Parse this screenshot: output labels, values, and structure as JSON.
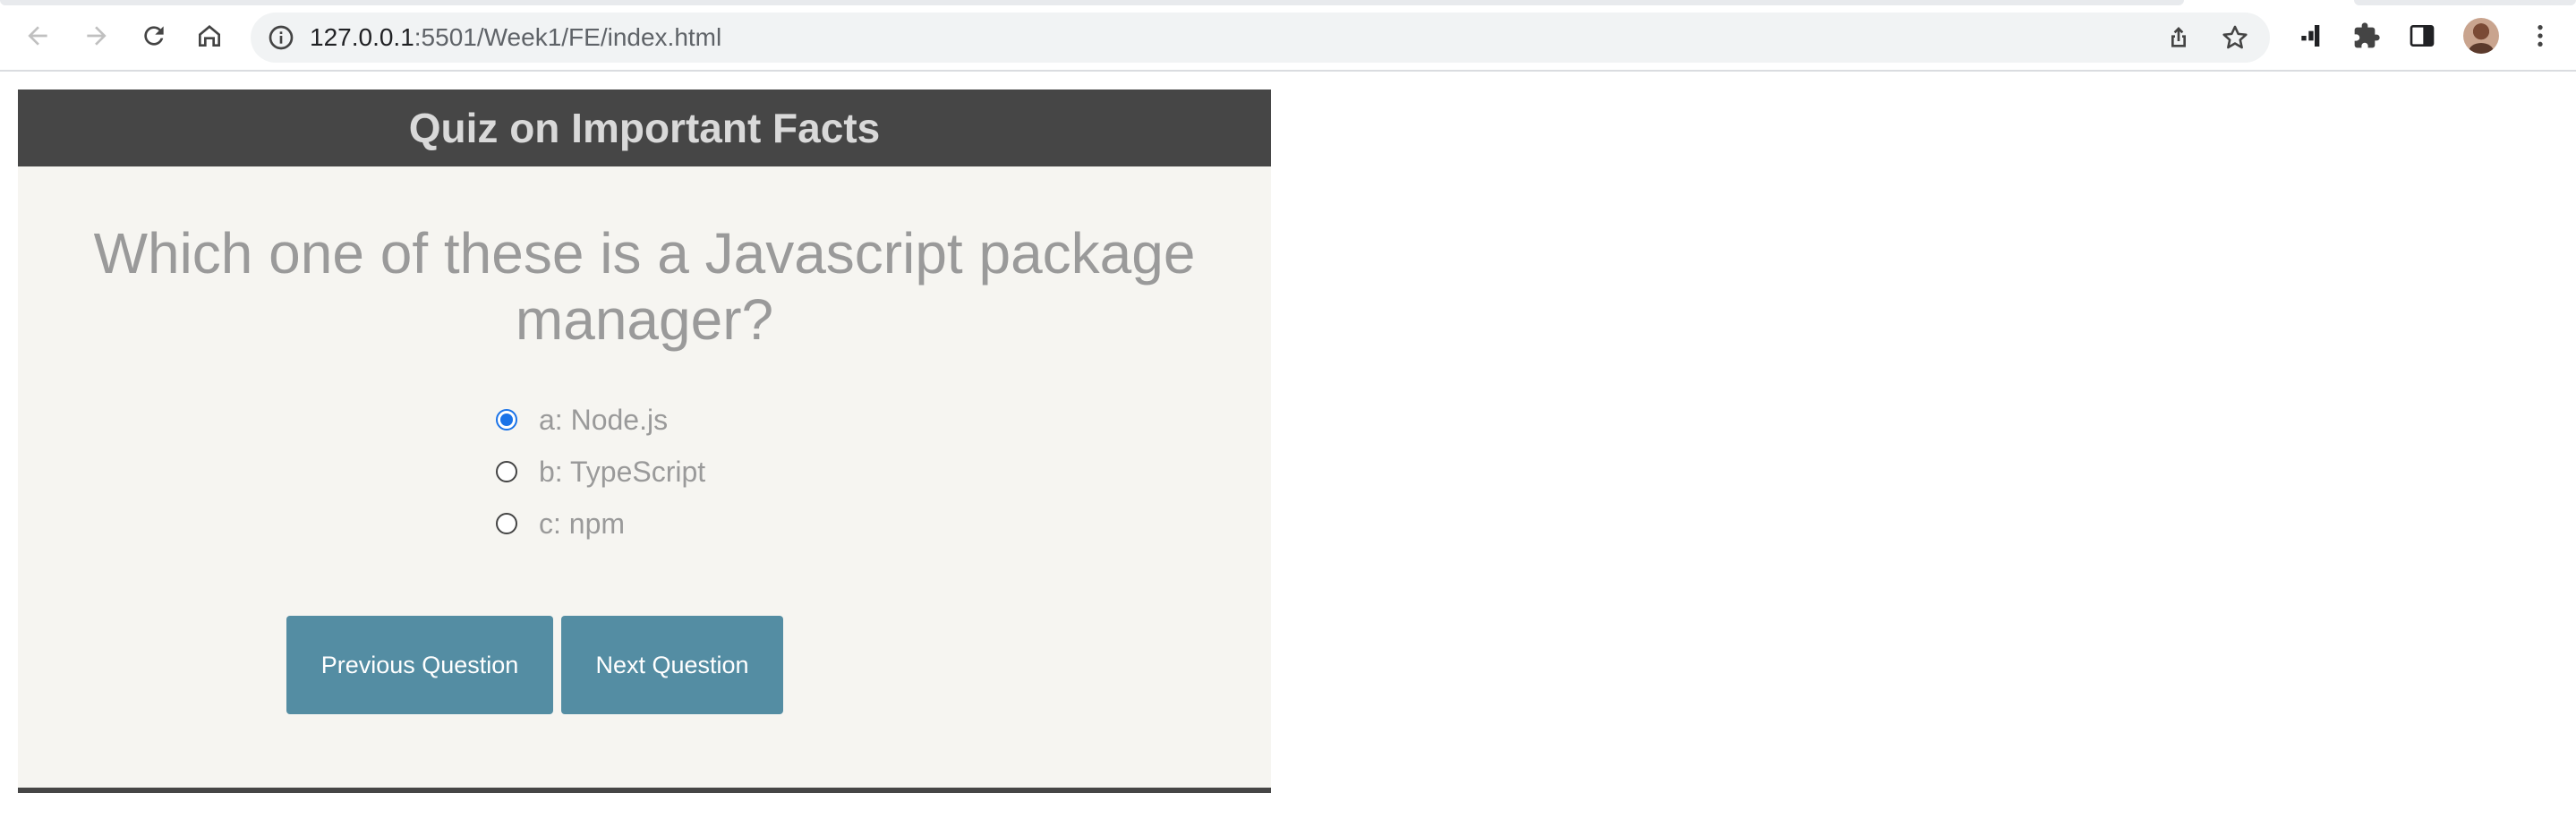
{
  "browser": {
    "url_host": "127.0.0.1",
    "url_rest": ":5501/Week1/FE/index.html"
  },
  "quiz": {
    "title": "Quiz on Important Facts",
    "question": "Which one of these is a Javascript package manager?",
    "answers": [
      {
        "label": "a: Node.js",
        "selected": true
      },
      {
        "label": "b: TypeScript",
        "selected": false
      },
      {
        "label": "c: npm",
        "selected": false
      }
    ],
    "prev_label": "Previous Question",
    "next_label": "Next Question"
  },
  "colors": {
    "header_bg": "#464646",
    "panel_bg": "#f6f5f1",
    "button_bg": "#548da3",
    "radio_checked": "#1a73e8"
  }
}
